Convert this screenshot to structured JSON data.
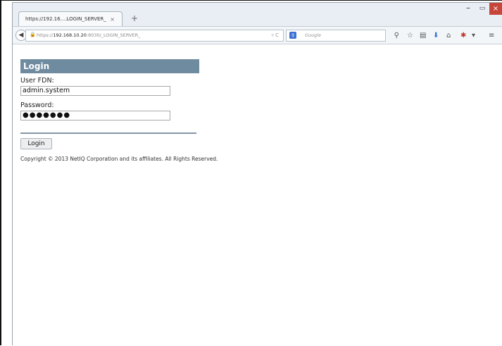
{
  "browser": {
    "tab_title": "https://192.16....LOGIN_SERVER_",
    "tab_close": "×",
    "new_tab": "+",
    "window_minimize": "–",
    "window_maximize": "▭",
    "window_close": "×",
    "url_prefix": "https://",
    "url_host": "192.168.10.20",
    "url_rest": ":8030/_LOGIN_SERVER_",
    "search_placeholder": "Google",
    "search_engine_icon": "google-icon",
    "toolbar_icons": [
      "bookmark-star-icon",
      "reading-list-icon",
      "download-icon",
      "home-icon",
      "extension-icon",
      "menu-icon"
    ]
  },
  "login": {
    "header": "Login",
    "user_label": "User FDN:",
    "user_value": "admin.system",
    "password_label": "Password:",
    "password_value": "●●●●●●●",
    "button_label": "Login",
    "copyright": "Copyright © 2013 NetIQ Corporation and its affiliates. All Rights Reserved."
  },
  "colors": {
    "header_bg": "#6f8b9f",
    "divider": "#8596a6",
    "close_button": "#c7463c"
  }
}
